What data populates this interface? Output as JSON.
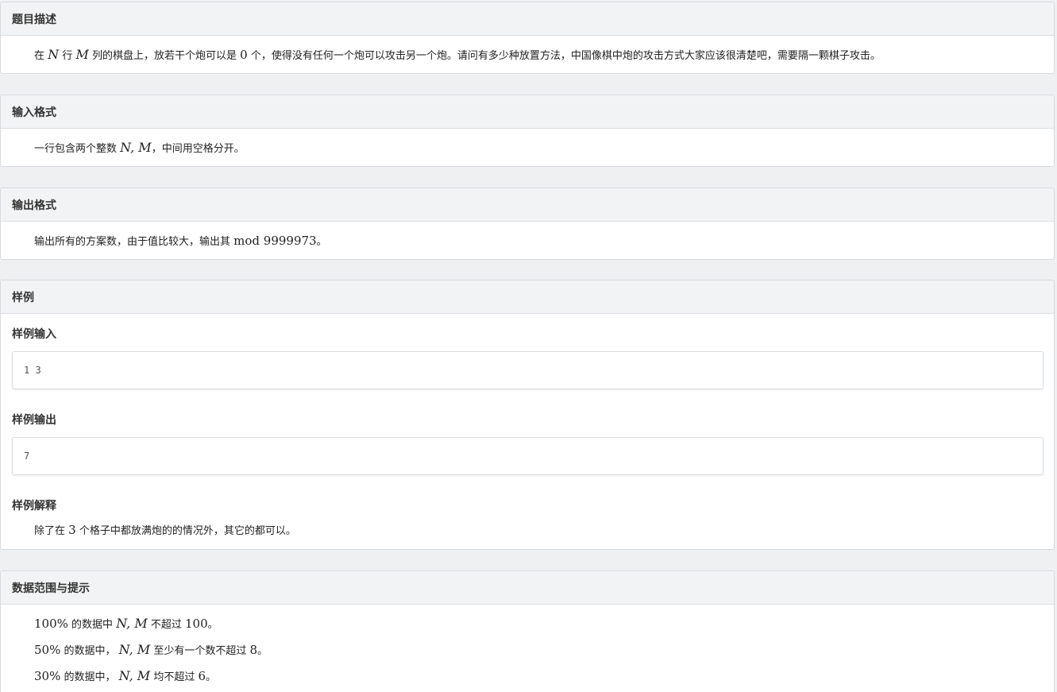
{
  "sections": {
    "description": {
      "title": "题目描述",
      "t1": "在",
      "m1": "N",
      "t2": "行",
      "m2": "M",
      "t3": "列的棋盘上，放若干个炮可以是",
      "m3": "0",
      "t4": "个，使得没有任何一个炮可以攻击另一个炮。请问有多少种放置方法，中国像棋中炮的攻击方式大家应该很清楚吧，需要隔一颗棋子攻击。"
    },
    "input_format": {
      "title": "输入格式",
      "t1": "一行包含两个整数",
      "m1": "N, M",
      "t2": "，中间用空格分开。"
    },
    "output_format": {
      "title": "输出格式",
      "t1": "输出所有的方案数，由于值比较大，输出其",
      "m1": "mod 9999973",
      "t2": "。"
    },
    "sample": {
      "title": "样例",
      "input_label": "样例输入",
      "input_value": "1 3",
      "output_label": "样例输出",
      "output_value": "7",
      "explain_label": "样例解释",
      "e1": "除了在",
      "em1": "3",
      "e2": "个格子中都放满炮的的情况外，其它的都可以。"
    },
    "constraints": {
      "title": "数据范围与提示",
      "l1_pct": "100%",
      "l1_a": "的数据中",
      "l1_m": "N, M",
      "l1_b": "不超过",
      "l1_v": "100",
      "l1_c": "。",
      "l2_pct": "50%",
      "l2_a": "的数据中，",
      "l2_m": "N, M",
      "l2_b": "至少有一个数不超过",
      "l2_v": "8",
      "l2_c": "。",
      "l3_pct": "30%",
      "l3_a": "的数据中，",
      "l3_m": "N, M",
      "l3_b": "均不超过",
      "l3_v": "6",
      "l3_c": "。"
    }
  }
}
